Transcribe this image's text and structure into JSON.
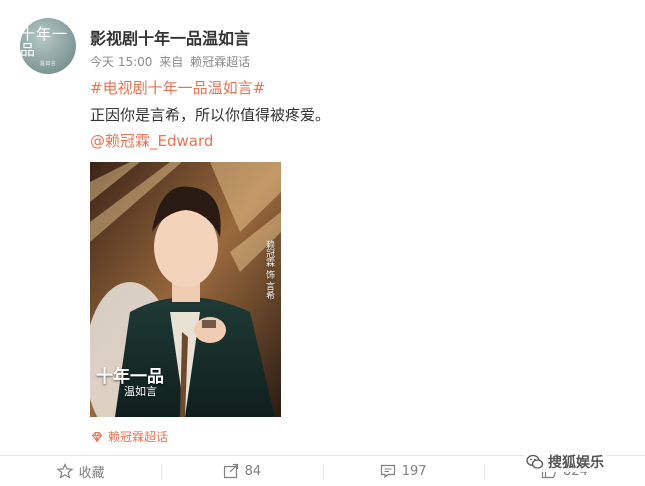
{
  "post": {
    "avatar_text": "十年一品",
    "avatar_sub": "温如言",
    "username": "影视剧十年一品温如言",
    "time": "今天 15:00",
    "source_prefix": "来自",
    "source": "赖冠霖超话",
    "hashtag": "#电视剧十年一品温如言#",
    "text": "正因你是言希，所以你值得被疼爱。",
    "mention": "@赖冠霖_Edward",
    "photo": {
      "title": "十年一品",
      "subtitle": "温如言",
      "vertical": "赖冠霖 饰 言希"
    },
    "location": "赖冠霖超话"
  },
  "actions": {
    "favorite_label": "收藏",
    "repost_count": "84",
    "comment_count": "197",
    "like_count": "824"
  },
  "watermark": {
    "text": "搜狐娱乐"
  },
  "colors": {
    "accent": "#eb7350",
    "muted": "#808080"
  }
}
